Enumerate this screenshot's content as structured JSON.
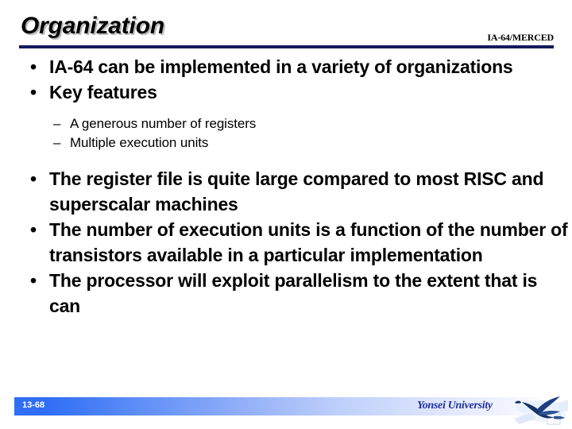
{
  "slide": {
    "title": "Organization",
    "header_tag": "IA-64/MERCED",
    "accent_navy": "#141a5e",
    "accent_blue": "#2f6ef5",
    "org_text_color": "#22319e",
    "bullet_marker": "•",
    "subbullet_marker": "–",
    "bullets": [
      {
        "level": 1,
        "text": "IA-64 can be implemented in a variety of organizations"
      },
      {
        "level": 1,
        "text": "Key features"
      },
      {
        "level": 2,
        "text": "A generous number of registers"
      },
      {
        "level": 2,
        "text": "Multiple execution units"
      },
      {
        "level": 1,
        "text": "The register file is quite large compared to most RISC and superscalar machines"
      },
      {
        "level": 1,
        "text": "The number of execution units is a function of the number of transistors available in a particular implementation"
      },
      {
        "level": 1,
        "text": "The processor will exploit parallelism to the extent that is can"
      }
    ]
  },
  "footer": {
    "page_number": "13-68",
    "organization": "Yonsei University",
    "logo_icon": "eagle-logo-icon"
  }
}
